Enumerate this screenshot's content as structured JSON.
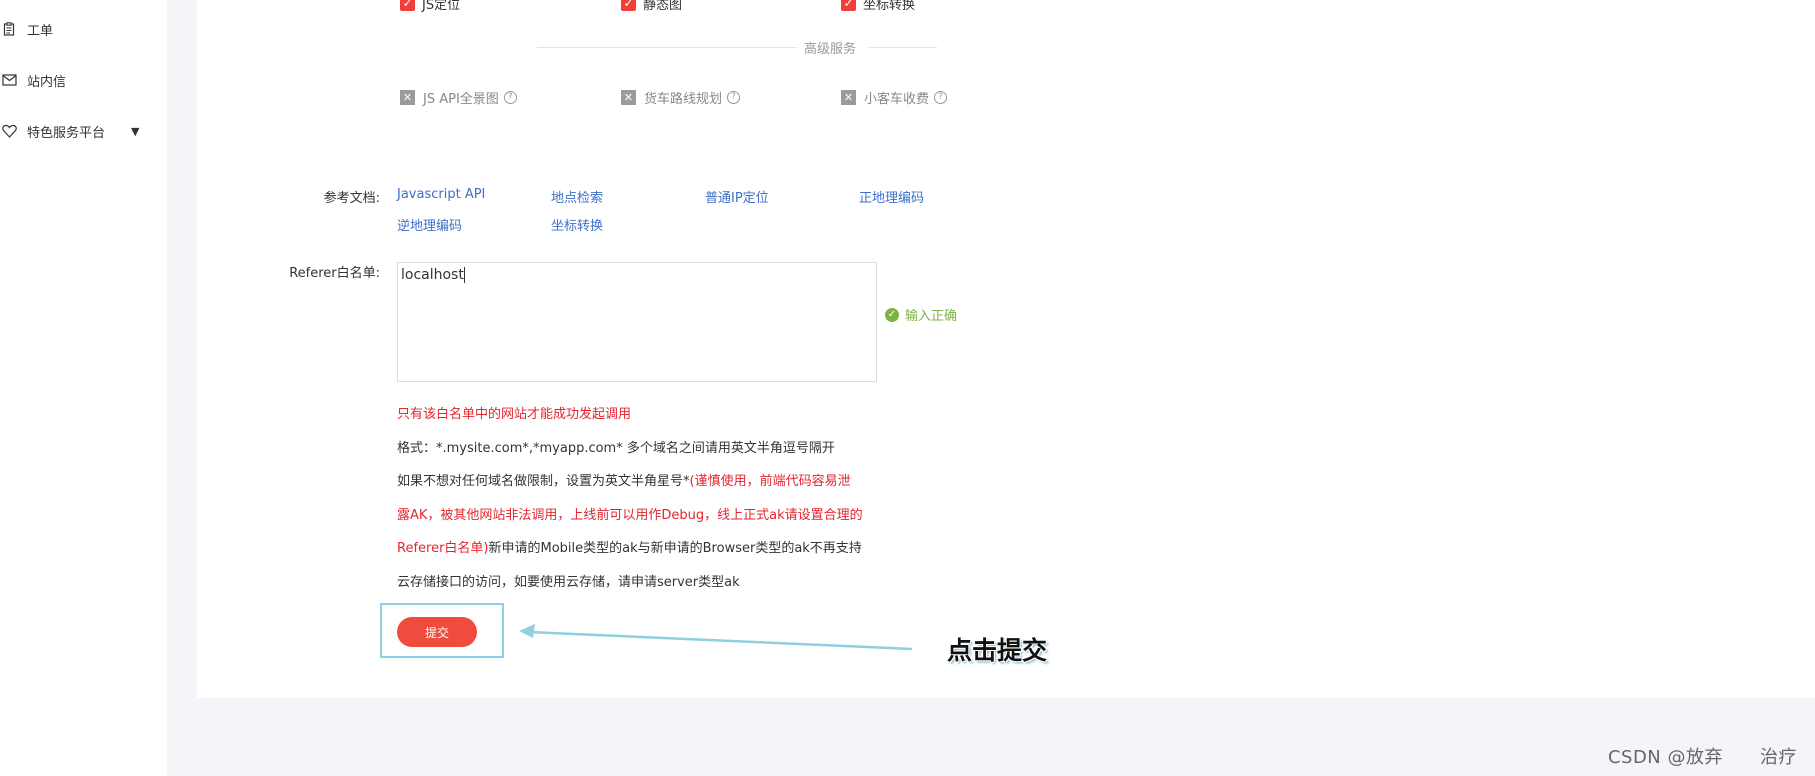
{
  "sidebar": {
    "items": [
      {
        "label": "工单",
        "icon": "clipboard-icon"
      },
      {
        "label": "站内信",
        "icon": "envelope-icon"
      },
      {
        "label": "特色服务平台",
        "icon": "heart-shield-icon",
        "has_dropdown": true
      }
    ]
  },
  "services": {
    "checked": [
      {
        "label": "JS定位",
        "checked": true
      },
      {
        "label": "静态图",
        "checked": true
      },
      {
        "label": "坐标转换",
        "checked": true
      }
    ],
    "advanced_title": "高级服务",
    "advanced": [
      {
        "label": "JS API全景图",
        "checked": false,
        "help": "?"
      },
      {
        "label": "货车路线规划",
        "checked": false,
        "help": "?"
      },
      {
        "label": "小客车收费",
        "checked": false,
        "help": "?"
      }
    ]
  },
  "docs": {
    "label": "参考文档:",
    "links": [
      "Javascript API",
      "地点检索",
      "普通IP定位",
      "正地理编码",
      "逆地理编码",
      "坐标转换"
    ]
  },
  "referer": {
    "label": "Referer白名单:",
    "value": "localhost",
    "validation": "输入正确"
  },
  "notes": {
    "line1": "只有该白名单中的网站才能成功发起调用",
    "line2": "格式：*.mysite.com*,*myapp.com* 多个域名之间请用英文半角逗号隔开",
    "line3_black": "如果不想对任何域名做限制，设置为英文半角星号*",
    "line3_red": "(谨慎使用，前端代码容易泄",
    "line4_red": "露AK，被其他网站非法调用，上线前可以用作Debug，线上正式ak请设置合理的",
    "line5_red": "Referer白名单)",
    "line5_black": "新申请的Mobile类型的ak与新申请的Browser类型的ak不再支持",
    "line6": "云存储接口的访问，如要使用云存储，请申请server类型ak"
  },
  "submit": {
    "label": "提交"
  },
  "annotation": {
    "text": "点击提交"
  },
  "watermark": "CSDN @放弃　　治疗",
  "colors": {
    "accent_red": "#ef4b3e",
    "link_blue": "#3c6fc8",
    "success_green": "#7cb342",
    "annotation_border": "#8bd0e4"
  }
}
